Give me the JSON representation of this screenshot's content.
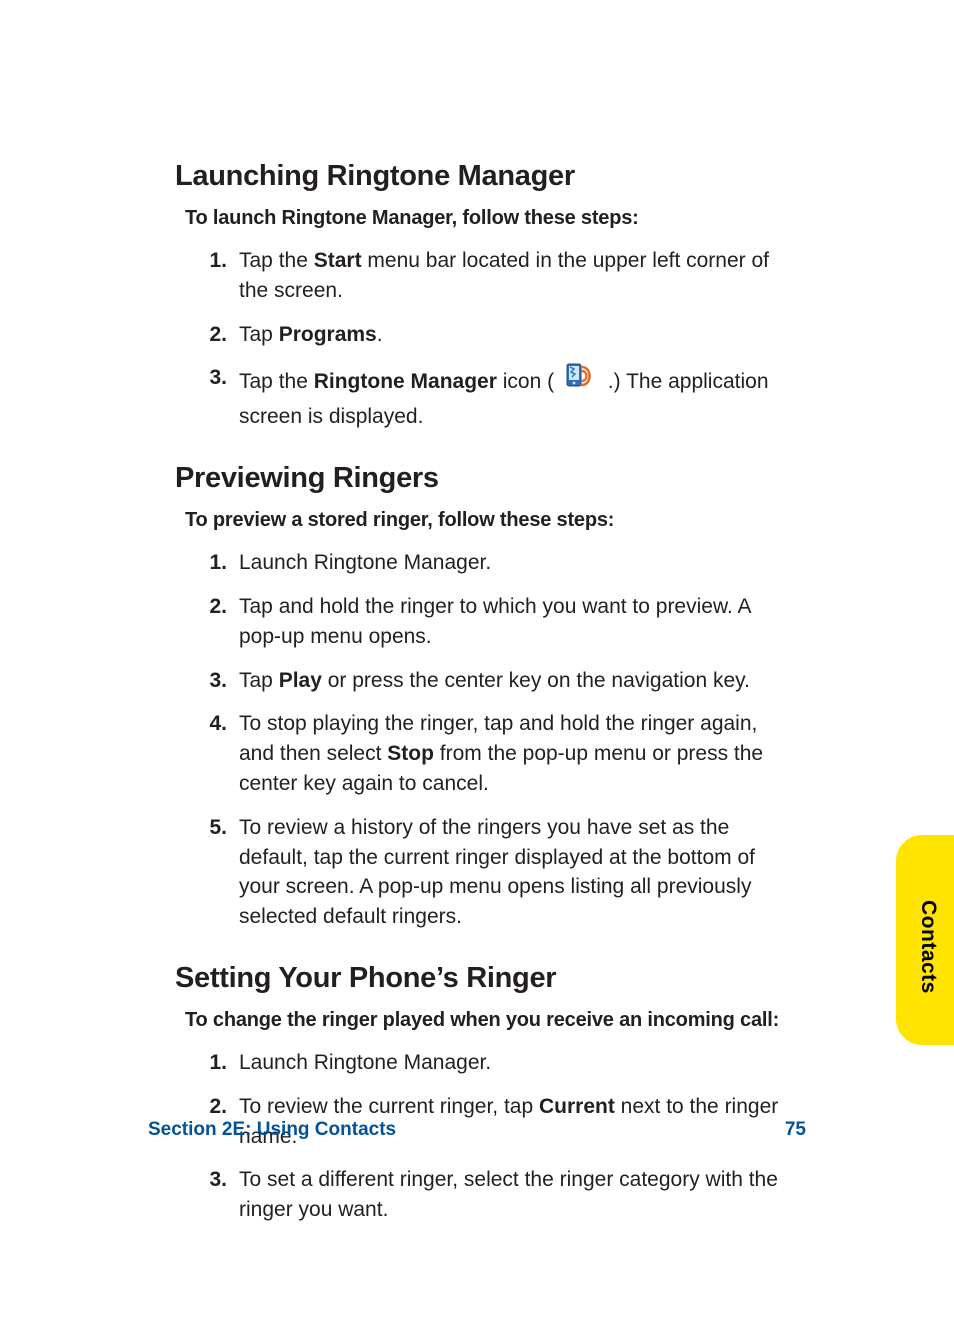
{
  "sections": {
    "launch": {
      "heading": "Launching Ringtone Manager",
      "intro": "To launch Ringtone Manager, follow these steps:",
      "steps": {
        "s1a": "Tap the ",
        "s1b": "Start",
        "s1c": " menu bar located in the upper left corner of the screen.",
        "s2a": "Tap ",
        "s2b": "Programs",
        "s2c": ".",
        "s3a": "Tap the ",
        "s3b": "Ringtone Manager",
        "s3c": " icon (",
        "s3d": ".) The application screen is displayed."
      }
    },
    "preview": {
      "heading": "Previewing Ringers",
      "intro": "To preview a stored ringer, follow these steps:",
      "steps": {
        "s1": "Launch Ringtone Manager.",
        "s2": "Tap and hold the ringer to which you want to preview. A pop-up menu opens.",
        "s3a": "Tap ",
        "s3b": "Play",
        "s3c": " or press the center key on the navigation key.",
        "s4a": "To stop playing the ringer, tap and hold the ringer again, and then select ",
        "s4b": "Stop",
        "s4c": " from the pop-up menu or press the center key again to cancel.",
        "s5": "To review a history of the ringers you have set as the default, tap the current ringer displayed at the bottom of your screen. A pop-up menu opens listing all previously selected default ringers."
      }
    },
    "setring": {
      "heading": "Setting Your Phone’s Ringer",
      "intro": "To change the ringer played when you receive an incoming call:",
      "steps": {
        "s1": "Launch Ringtone Manager.",
        "s2a": "To review the current ringer, tap ",
        "s2b": "Current",
        "s2c": " next to the ringer name.",
        "s3": "To set a different ringer, select the ringer category with the ringer you want."
      }
    }
  },
  "sidetab": {
    "label": "Contacts"
  },
  "footer": {
    "left": "Section 2E: Using Contacts",
    "right": "75"
  }
}
